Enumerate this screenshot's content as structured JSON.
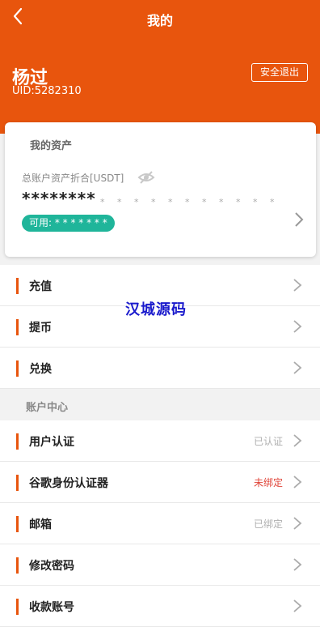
{
  "header": {
    "title": "我的",
    "username": "杨过",
    "uid": "UID:5282310",
    "logout_label": "安全退出"
  },
  "assets": {
    "title": "我的资产",
    "total_label": "总账户资产折合[USDT]",
    "total_masked": "********",
    "total_sub_masked": "* * * * * * * * * * *",
    "available": "可用: * * * * * * *"
  },
  "menu_top": [
    {
      "label": "充值"
    },
    {
      "label": "提币"
    },
    {
      "label": "兑换"
    }
  ],
  "section_title": "账户中心",
  "menu_account": [
    {
      "label": "用户认证",
      "status": "已认证"
    },
    {
      "label": "谷歌身份认证器",
      "status": "未绑定"
    },
    {
      "label": "邮箱",
      "status": "已绑定"
    },
    {
      "label": "修改密码",
      "status": ""
    },
    {
      "label": "收款账号",
      "status": ""
    }
  ],
  "watermark": "汉城源码",
  "colors": {
    "brand": "#e8550d",
    "available_badge": "#1fb59a",
    "status_done": "#b0b0b0",
    "status_unbound": "#e0463a"
  }
}
